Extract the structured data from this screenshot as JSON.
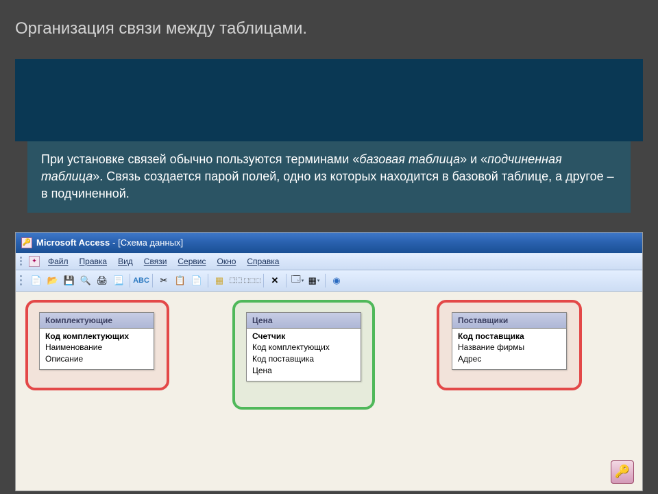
{
  "slide": {
    "title": "Организация связи между таблицами.",
    "body_prefix": "При установке связей обычно пользуются терминами «",
    "body_term1": "базовая таблица",
    "body_mid1": "» и «",
    "body_term2": "подчиненная таблица",
    "body_suffix": "». Связь создается парой полей, одно из которых находится в базовой таблице, а другое – в подчиненной."
  },
  "window": {
    "app_name": "Microsoft Access",
    "doc_title": " - [Схема данных]"
  },
  "menu": {
    "file": "Файл",
    "edit": "Правка",
    "view": "Вид",
    "rel": "Связи",
    "tools": "Сервис",
    "window": "Окно",
    "help": "Справка"
  },
  "tables": {
    "t1": {
      "title": "Комплектующие",
      "pk": "Код комплектующих",
      "f1": "Наименование",
      "f2": "Описание"
    },
    "t2": {
      "title": "Цена",
      "pk": "Счетчик",
      "f1": "Код комплектующих",
      "f2": "Код поставщика",
      "f3": "Цена"
    },
    "t3": {
      "title": "Поставщики",
      "pk": "Код поставщика",
      "f1": "Название фирмы",
      "f2": "Адрес"
    }
  }
}
